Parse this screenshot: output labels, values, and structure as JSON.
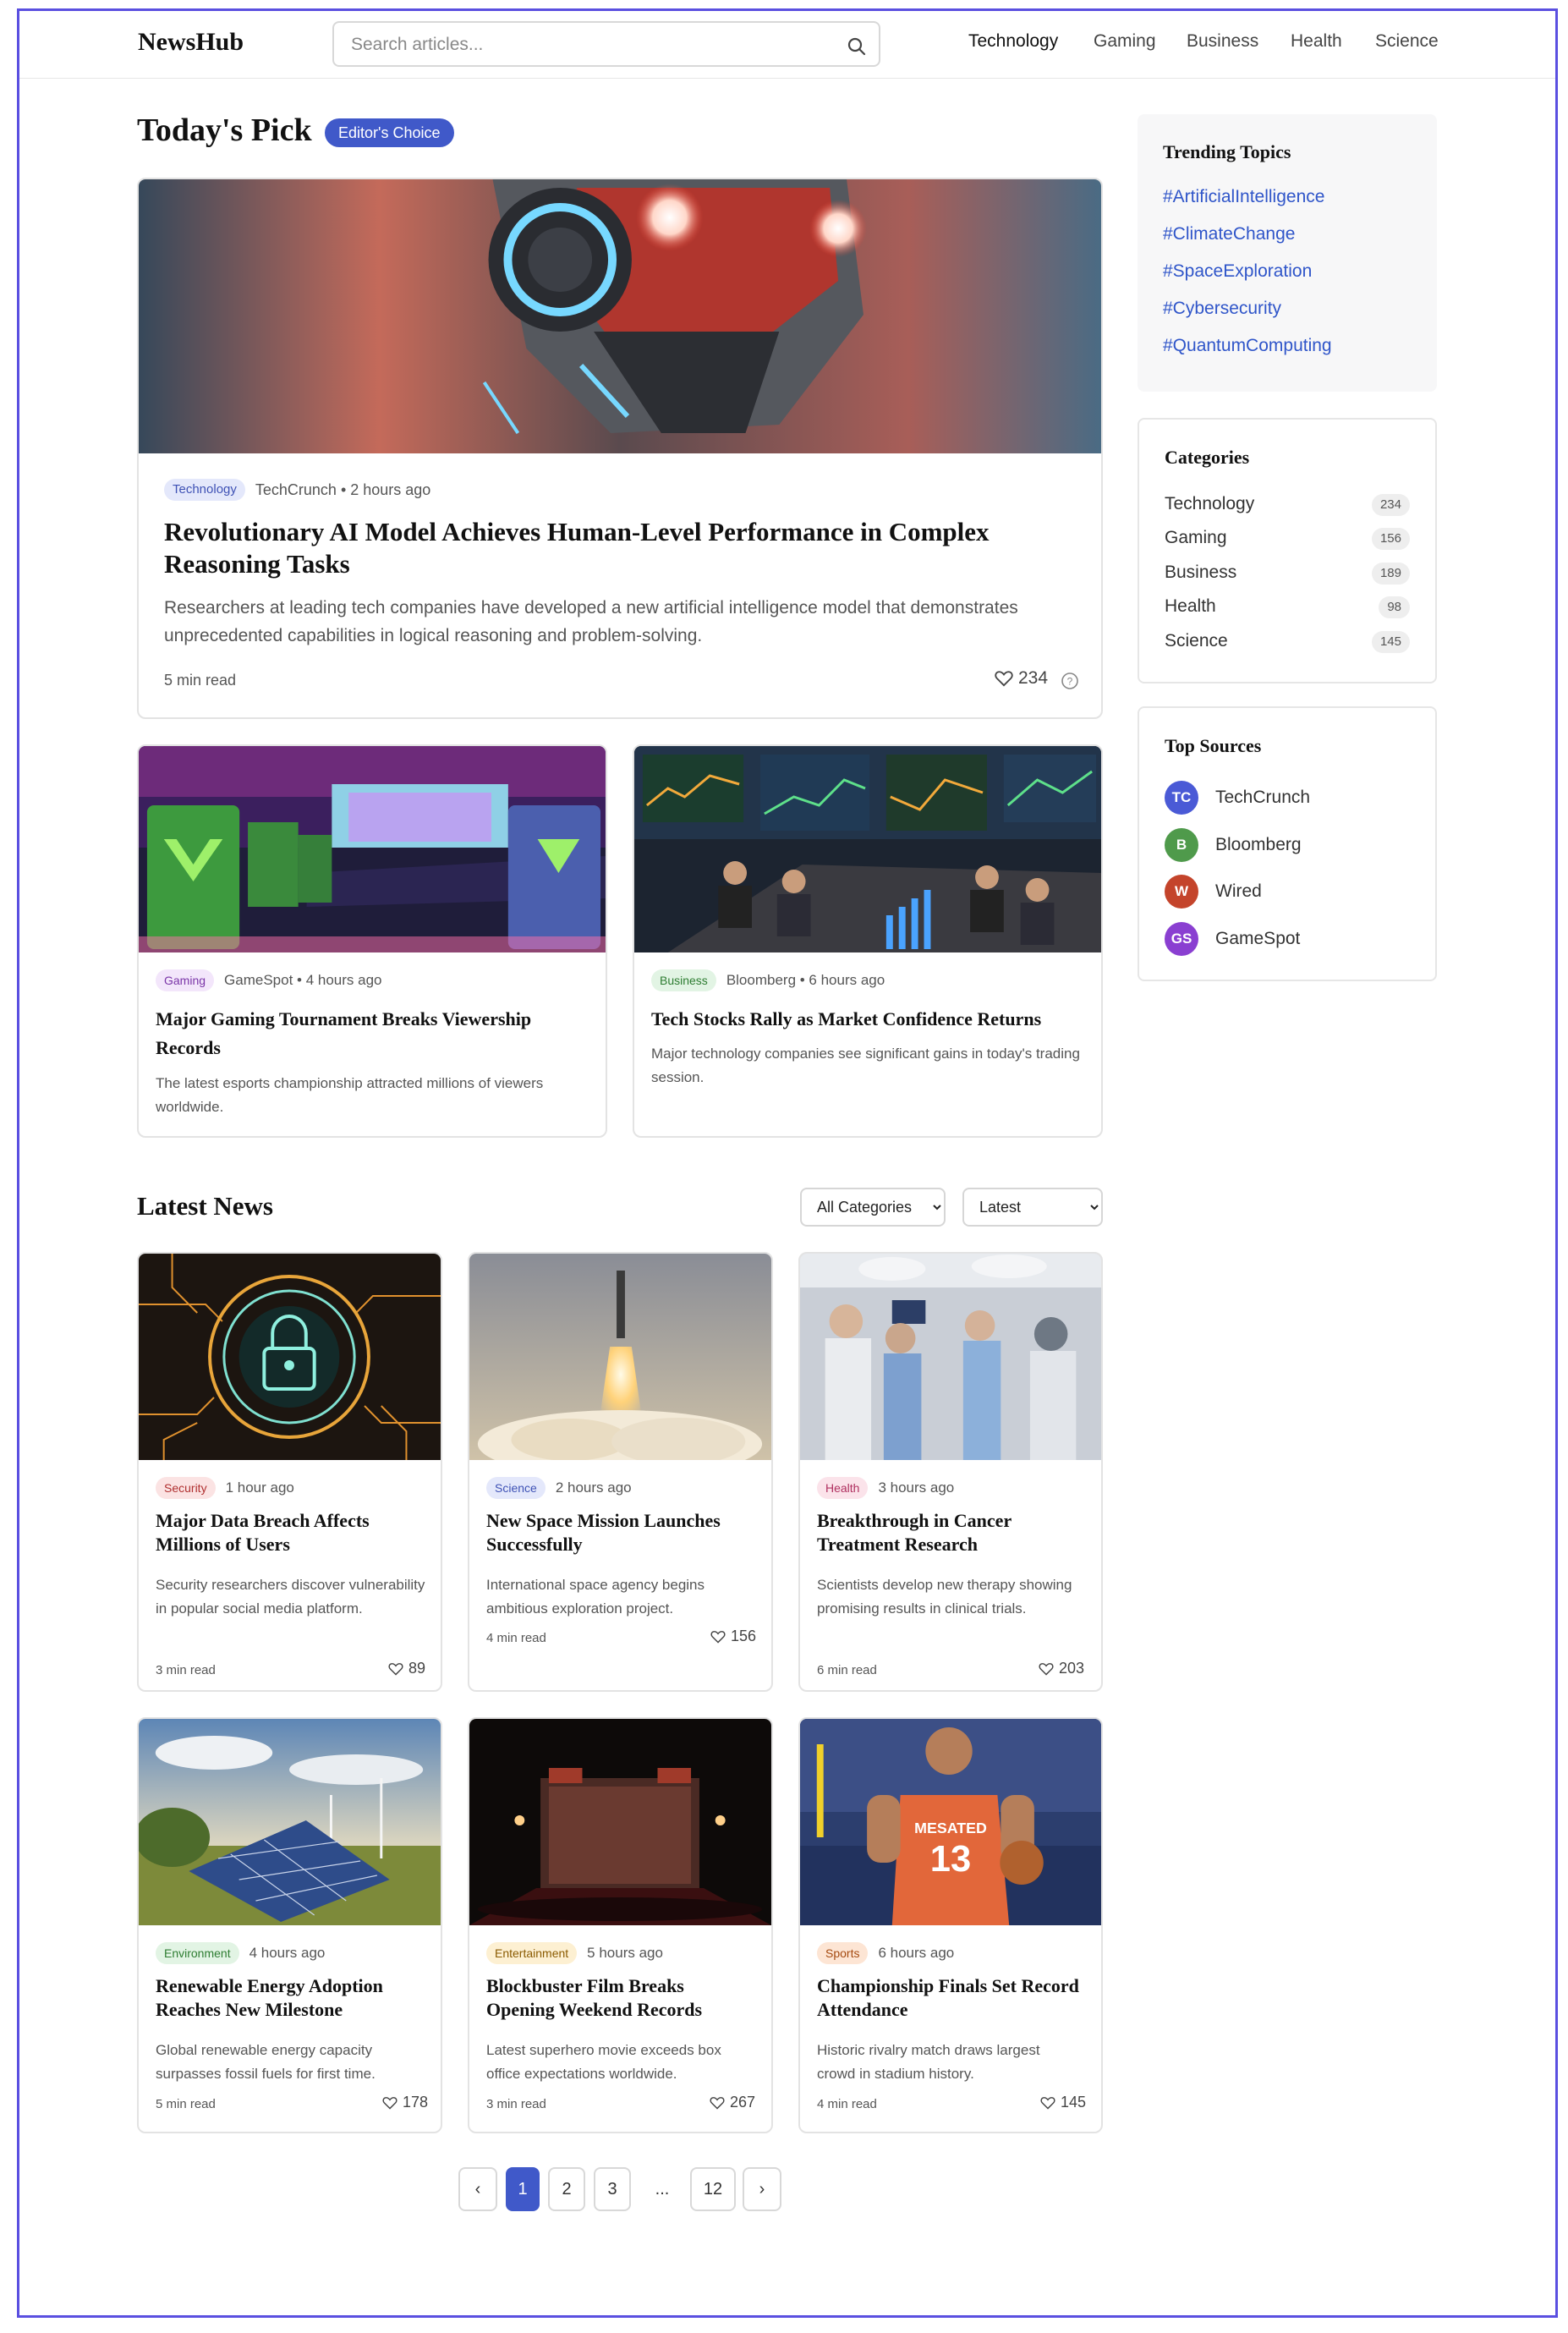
{
  "header": {
    "logo": "NewsHub",
    "search_placeholder": "Search articles...",
    "nav": [
      "Technology",
      "Gaming",
      "Business",
      "Health",
      "Science"
    ],
    "active_nav": "Technology"
  },
  "pick": {
    "title": "Today's Pick",
    "badge": "Editor's Choice",
    "featured": {
      "tag": "Technology",
      "source_time": "TechCrunch • 2 hours ago",
      "title": "Revolutionary AI Model Achieves Human-Level Performance in Complex Reasoning Tasks",
      "desc": "Researchers at leading tech companies have developed a new artificial intelligence model that demonstrates unprecedented capabilities in logical reasoning and problem-solving.",
      "read": "5 min read",
      "likes": "234"
    },
    "secondary": [
      {
        "tag": "Gaming",
        "source_time": "GameSpot • 4 hours ago",
        "title": "Major Gaming Tournament Breaks Viewership Records",
        "desc": "The latest esports championship attracted millions of viewers worldwide."
      },
      {
        "tag": "Business",
        "source_time": "Bloomberg • 6 hours ago",
        "title": "Tech Stocks Rally as Market Confidence Returns",
        "desc": "Major technology companies see significant gains in today's trading session."
      }
    ]
  },
  "latest": {
    "title": "Latest News",
    "filter_category": "All Categories",
    "filter_sort": "Latest",
    "articles": [
      {
        "tag": "Security",
        "time": "1 hour ago",
        "title": "Major Data Breach Affects Millions of Users",
        "desc": "Security researchers discover vulnerability in popular social media platform.",
        "read": "3 min read",
        "likes": "89"
      },
      {
        "tag": "Science",
        "time": "2 hours ago",
        "title": "New Space Mission Launches Successfully",
        "desc": "International space agency begins ambitious exploration project.",
        "read": "4 min read",
        "likes": "156"
      },
      {
        "tag": "Health",
        "time": "3 hours ago",
        "title": "Breakthrough in Cancer Treatment Research",
        "desc": "Scientists develop new therapy showing promising results in clinical trials.",
        "read": "6 min read",
        "likes": "203"
      },
      {
        "tag": "Environment",
        "time": "4 hours ago",
        "title": "Renewable Energy Adoption Reaches New Milestone",
        "desc": "Global renewable energy capacity surpasses fossil fuels for first time.",
        "read": "5 min read",
        "likes": "178"
      },
      {
        "tag": "Entertainment",
        "time": "5 hours ago",
        "title": "Blockbuster Film Breaks Opening Weekend Records",
        "desc": "Latest superhero movie exceeds box office expectations worldwide.",
        "read": "3 min read",
        "likes": "267"
      },
      {
        "tag": "Sports",
        "time": "6 hours ago",
        "title": "Championship Finals Set Record Attendance",
        "desc": "Historic rivalry match draws largest crowd in stadium history.",
        "read": "4 min read",
        "likes": "145"
      }
    ],
    "jersey_text": "MESATED",
    "jersey_number": "13"
  },
  "pagination": {
    "prev": "‹",
    "pages": [
      "1",
      "2",
      "3"
    ],
    "ellipsis": "...",
    "last": "12",
    "next": "›",
    "current": "1"
  },
  "sidebar": {
    "trending_title": "Trending Topics",
    "trending": [
      "#ArtificialIntelligence",
      "#ClimateChange",
      "#SpaceExploration",
      "#Cybersecurity",
      "#QuantumComputing"
    ],
    "categories_title": "Categories",
    "categories": [
      {
        "name": "Technology",
        "count": "234"
      },
      {
        "name": "Gaming",
        "count": "156"
      },
      {
        "name": "Business",
        "count": "189"
      },
      {
        "name": "Health",
        "count": "98"
      },
      {
        "name": "Science",
        "count": "145"
      }
    ],
    "sources_title": "Top Sources",
    "sources": [
      {
        "initials": "TC",
        "name": "TechCrunch",
        "color": "#4a5ad6"
      },
      {
        "initials": "B",
        "name": "Bloomberg",
        "color": "#4f9a4b"
      },
      {
        "initials": "W",
        "name": "Wired",
        "color": "#c4442b"
      },
      {
        "initials": "GS",
        "name": "GameSpot",
        "color": "#8a3fd1"
      }
    ]
  },
  "colors": {
    "accent": "#4059c9",
    "link": "#2f55c9",
    "frame": "#5a4fe0"
  }
}
